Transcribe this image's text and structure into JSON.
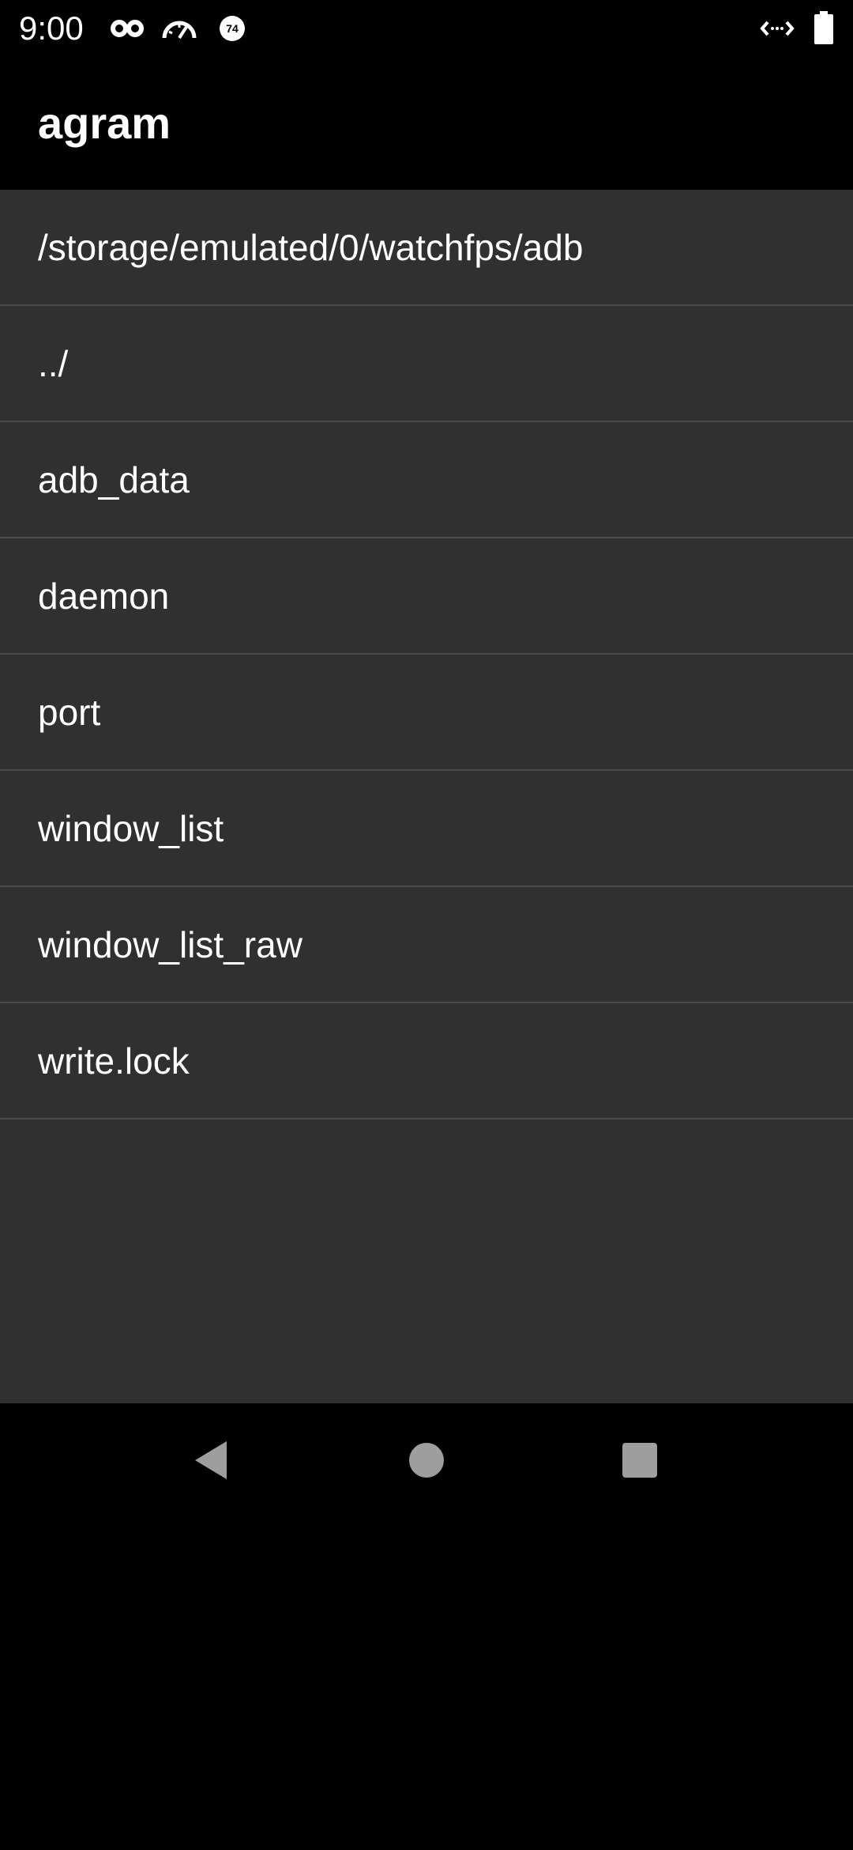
{
  "status_bar": {
    "time": "9:00",
    "icons": [
      "incognito-icon",
      "speedometer-icon",
      "badge-74-icon",
      "data-transfer-icon",
      "battery-icon"
    ],
    "badge_number": "74"
  },
  "app_bar": {
    "title": "agram"
  },
  "file_browser": {
    "current_path": "/storage/emulated/0/watchfps/adb",
    "items": [
      {
        "label": "../"
      },
      {
        "label": "adb_data"
      },
      {
        "label": "daemon"
      },
      {
        "label": "port"
      },
      {
        "label": "window_list"
      },
      {
        "label": "window_list_raw"
      },
      {
        "label": "write.lock"
      }
    ]
  },
  "nav_bar": {
    "buttons": [
      "back-icon",
      "home-icon",
      "recents-icon"
    ]
  },
  "colors": {
    "background": "#000000",
    "list_background": "#303030",
    "divider": "#4a4a4a",
    "text": "#ffffff",
    "nav_icon": "#9e9e9e"
  }
}
